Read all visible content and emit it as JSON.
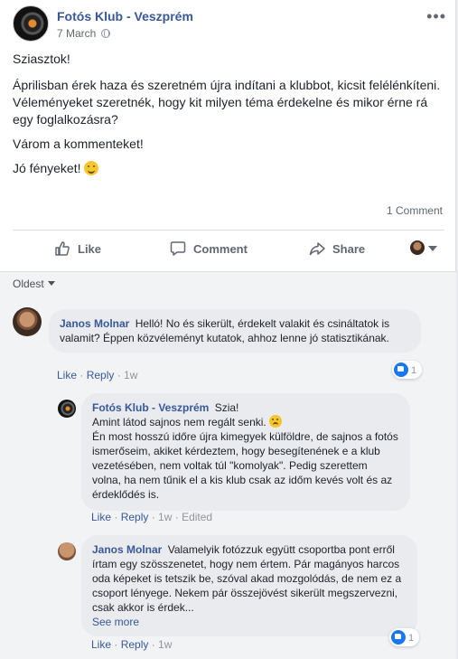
{
  "post": {
    "page_name": "Fotós Klub - Veszprém",
    "date": "7 March",
    "more_label": "•••",
    "greeting": "Sziasztok!",
    "line1": "Áprilisban érek haza és szeretném újra indítani a klubbot, kicsit felélénkíteni.",
    "line2": "Véleményeket szeretnék, hogy kit milyen téma érdekelne és mikor érne rá egy foglalkozásra?",
    "line3": "Várom a kommenteket!",
    "line4": "Jó fényeket!",
    "comment_count": "1 Comment",
    "icons": {
      "privacy": "globe-icon",
      "emoji": "smiling-emoji-icon"
    }
  },
  "actions": {
    "like": "Like",
    "comment": "Comment",
    "share": "Share",
    "icons": [
      "thumbs-up-icon",
      "comment-icon",
      "share-icon",
      "chevron-down-icon"
    ]
  },
  "sort": {
    "label": "Oldest"
  },
  "comments": [
    {
      "author": "Janos Molnar",
      "text": "Helló! No és sikerült, érdekelt valakit és csináltatok is valamit? Éppen közvéleményt kutatok, ahhoz lenne jó statisztikának.",
      "like": "Like",
      "reply": "Reply",
      "age": "1w",
      "reactions": "1"
    },
    {
      "author": "Fotós Klub - Veszprém",
      "text_a": "Szia!",
      "text_b": "Amint látod sajnos nem regált senki.",
      "text_c": "Én most hosszú időre újra kimegyek külföldre, de sajnos a fotós ismerőseim, akiket kérdeztem, hogy besegítenének e a klub vezetésében, nem voltak túl \"komolyak\". Pedig szerettem volna, ha nem tűnik el a kis klub csak az időm kevés volt és az érdeklődés is.",
      "like": "Like",
      "reply": "Reply",
      "age": "1w",
      "edited": "Edited"
    },
    {
      "author": "Janos Molnar",
      "text": "Valamelyik fotózzuk együtt csoportba pont erről írtam egy szösszenetet, hogy nem értem. Pár magányos harcos oda képeket is tetszik be, szóval akad mozgolódás, de nem ez a csoport lényege. Nekem pár összejövést sikerült megszervezni, csak akkor is érdek...",
      "see_more": "See more",
      "like": "Like",
      "reply": "Reply",
      "age": "1w",
      "reactions": "1"
    }
  ],
  "colors": {
    "link": "#385898",
    "muted": "#90949c",
    "bubble": "#e9ebee",
    "like_blue": "#1877f2"
  }
}
